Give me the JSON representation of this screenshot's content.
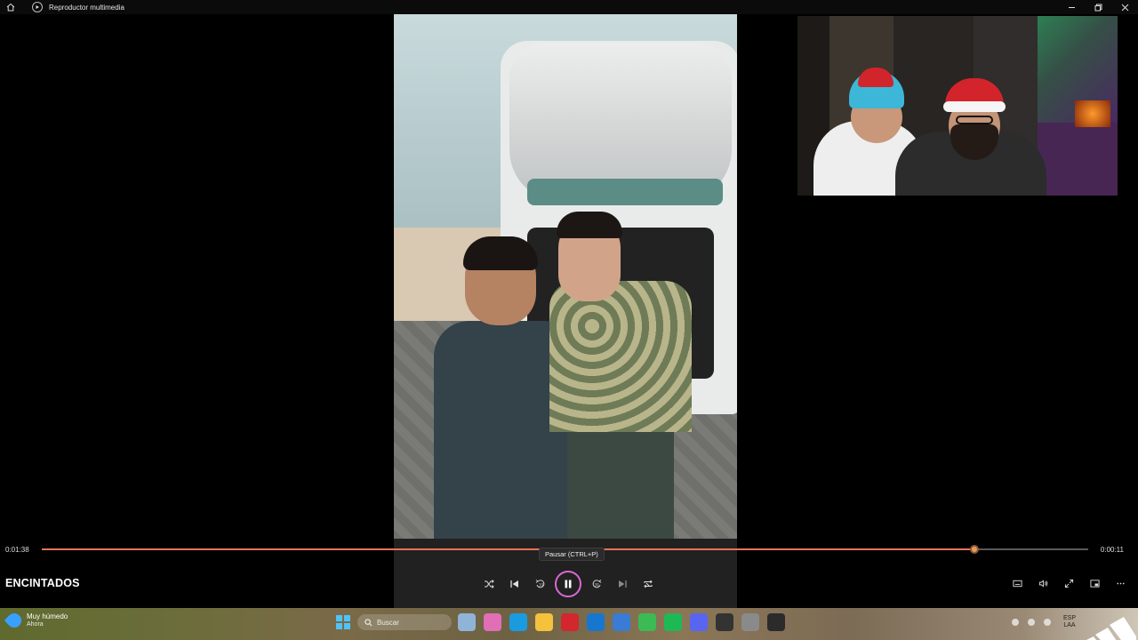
{
  "window": {
    "title": "Reproductor multimedia",
    "controls": [
      "minimize",
      "restore",
      "close"
    ]
  },
  "player": {
    "time_elapsed": "0:01:38",
    "time_remaining": "0:00:11",
    "progress": 0.891,
    "tooltip": "Pausar (CTRL+P)",
    "media_title": "ENCINTADOS",
    "transport_buttons": [
      "shuffle-icon",
      "previous-icon",
      "rewind-10-icon",
      "pause-icon",
      "forward-30-icon",
      "next-icon",
      "repeat-icon"
    ],
    "right_buttons": [
      "subtitles-icon",
      "volume-icon",
      "fullscreen-icon",
      "miniplayer-icon",
      "more-icon"
    ],
    "colors": {
      "seek_fill": "#e8735a",
      "play_ring": "#d86ad0"
    }
  },
  "taskbar": {
    "weather_title": "Muy húmedo",
    "weather_sub": "Ahora",
    "search_placeholder": "Buscar",
    "lang_top": "ESP",
    "lang_bottom": "LAA",
    "apps": [
      {
        "name": "car-app-icon",
        "color": "#8fb4d8"
      },
      {
        "name": "copilot-icon",
        "color": "#e06fb5"
      },
      {
        "name": "edge-icon",
        "color": "#1a9be0"
      },
      {
        "name": "file-explorer-icon",
        "color": "#f4c23c"
      },
      {
        "name": "red-app-icon",
        "color": "#d3262d"
      },
      {
        "name": "outlook-icon",
        "color": "#1777cf"
      },
      {
        "name": "store-icon",
        "color": "#3a7bd5"
      },
      {
        "name": "chrome-icon",
        "color": "#3cba54"
      },
      {
        "name": "spotify-icon",
        "color": "#1db954"
      },
      {
        "name": "discord-icon",
        "color": "#5865f2"
      },
      {
        "name": "obs-icon",
        "color": "#333333"
      },
      {
        "name": "settings-icon",
        "color": "#8a8a8a"
      },
      {
        "name": "media-player-icon",
        "color": "#2b2b2b"
      }
    ]
  }
}
